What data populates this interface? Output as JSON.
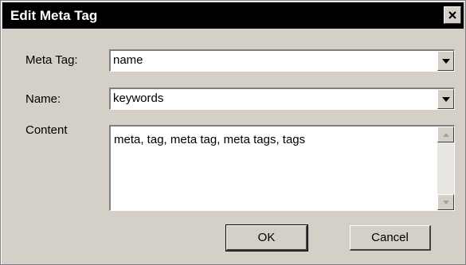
{
  "window": {
    "title": "Edit Meta Tag",
    "close_icon": "close-icon"
  },
  "form": {
    "meta_tag": {
      "label": "Meta Tag:",
      "value": "name",
      "dropdown_icon": "chevron-down-icon"
    },
    "name": {
      "label": "Name:",
      "value": "keywords",
      "dropdown_icon": "chevron-down-icon"
    },
    "content": {
      "label": "Content",
      "value": "meta, tag, meta tag, meta tags, tags"
    }
  },
  "buttons": {
    "ok_label": "OK",
    "cancel_label": "Cancel"
  },
  "colors": {
    "dialog_bg": "#d4d0c8",
    "titlebar_bg": "#000000",
    "titlebar_text": "#ffffff"
  }
}
